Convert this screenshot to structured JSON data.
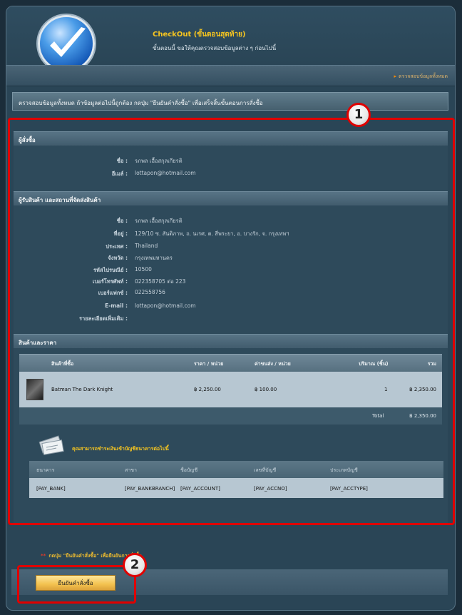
{
  "header": {
    "title": "CheckOut (ขั้นตอนสุดท้าย)",
    "subtitle": "ขั้นตอนนี้ ขอให้คุณตรวจสอบข้อมูลต่าง ๆ ก่อนไปนี้"
  },
  "breadcrumb": "ตรวจสอบข้อมูลทั้งหมด",
  "intro": "ตรวจสอบข้อมูลทั้งหมด ถ้าข้อมูลต่อไปนี้ถูกต้อง กดปุ่ม \"ยืนยันคำสั่งซื้อ\" เพื่อเสร็จสิ้นขั้นตอนการสั่งซื้อ",
  "buyer": {
    "heading": "ผู้สั่งซื้อ",
    "name_label": "ชื่อ :",
    "name": "รภพล เอื้อสกุลเกียรติ",
    "email_label": "อีเมล์ :",
    "email": "lottapon@hotmail.com"
  },
  "shipping": {
    "heading": "ผู้รับสินค้า และสถานที่จัดส่งสินค้า",
    "name_label": "ชื่อ :",
    "name": "รภพล เอื้อสกุลเกียรติ",
    "address_label": "ที่อยู่ :",
    "address": "129/10 ซ. สันติภาพ, ถ. นเรศ, ต. สี่พระยา, อ. บางรัก, จ. กรุงเทพฯ",
    "country_label": "ประเทศ :",
    "country": "Thailand",
    "province_label": "จังหวัด :",
    "province": "กรุงเทพมหานคร",
    "zip_label": "รหัสไปรษณีย์ :",
    "zip": "10500",
    "phone_label": "เบอร์โทรศัพท์ :",
    "phone": "022358705 ต่อ 223",
    "fax_label": "เบอร์แฟกซ์ :",
    "fax": "022558756",
    "email_label": "E-mail :",
    "email": "lottapon@hotmail.com",
    "details_label": "รายละเอียดเพิ่มเติม :"
  },
  "products": {
    "heading": "สินค้าและราคา",
    "columns": [
      "สินค้าที่ซื้อ",
      "ราคา / หน่วย",
      "ค่าขนส่ง / หน่วย",
      "ปริมาณ (ชิ้น)",
      "รวม"
    ],
    "rows": [
      {
        "name": "Batman The Dark Knight",
        "price": "฿ 2,250.00",
        "shipping": "฿ 100.00",
        "qty": "1",
        "total": "฿ 2,350.00"
      }
    ],
    "total_label": "Total",
    "total_value": "฿ 2,350.00"
  },
  "payment": {
    "note": "คุณสามารถชำระเงินเข้าบัญชีธนาคารต่อไปนี้",
    "columns": [
      "ธนาคาร",
      "สาขา",
      "ชื่อบัญชี",
      "เลขที่บัญชี",
      "ประเภทบัญชี"
    ],
    "row": [
      "[PAY_BANK]",
      "[PAY_BANKBRANCH]",
      "[PAY_ACCOUNT]",
      "[PAY_ACCNO]",
      "[PAY_ACCTYPE]"
    ]
  },
  "instruction": {
    "star": "**",
    "text": "กดปุ่ม \"ยืนยันคำสั่งซื้อ\" เพื่อยืนยันการสั่งซื้อ."
  },
  "confirm_label": "ยืนยันคำสั่งซื้อ",
  "callouts": [
    "1",
    "2"
  ],
  "colors": {
    "accent": "#f6c520",
    "highlight": "#e00000",
    "button": "#f3c24f"
  }
}
